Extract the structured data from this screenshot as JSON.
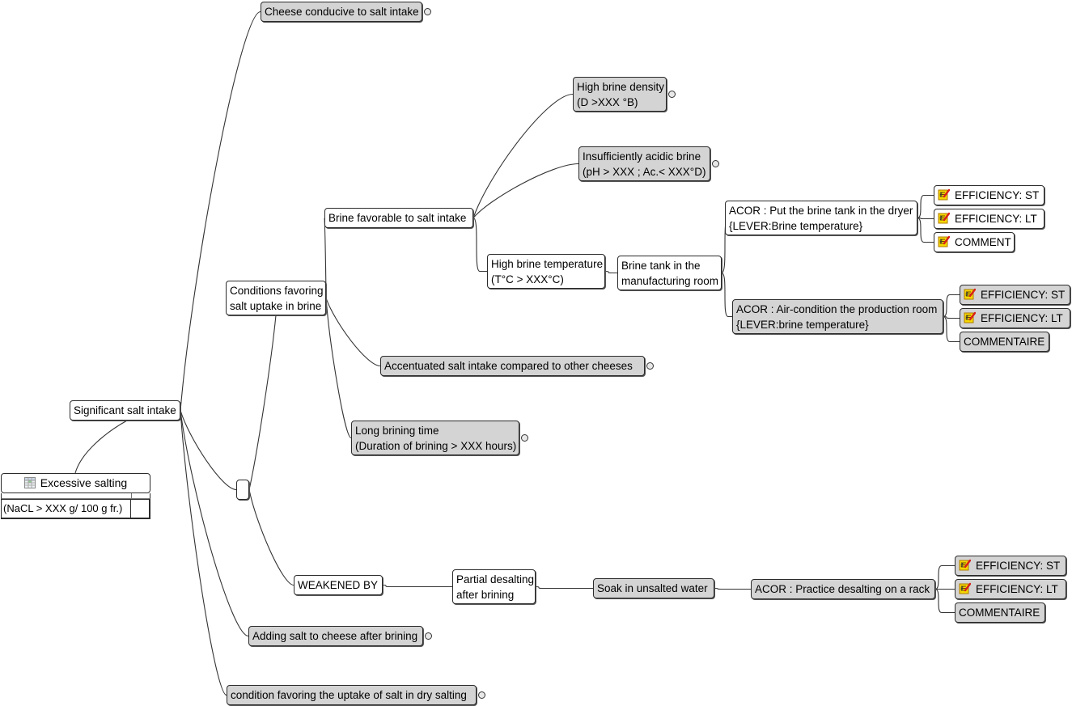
{
  "diagram": {
    "type": "cause-tree mind map",
    "root": {
      "icon": "table-icon",
      "title": "Excessive salting",
      "detail": "(NaCL > XXX g/ 100 g fr.)"
    },
    "nodes": {
      "significant": {
        "lines": [
          "Significant salt intake"
        ]
      },
      "cheese_conducive": {
        "lines": [
          "Cheese conducive to salt intake"
        ]
      },
      "conditions_brine": {
        "lines": [
          "Conditions favoring",
          "salt uptake in brine"
        ]
      },
      "brine_favorable": {
        "lines": [
          "Brine favorable to salt intake"
        ]
      },
      "high_density": {
        "lines": [
          "High brine density",
          "(D >XXX °B)"
        ]
      },
      "acidic": {
        "lines": [
          "Insufficiently acidic brine",
          "(pH > XXX ; Ac.< XXX°D)"
        ]
      },
      "high_temp": {
        "lines": [
          "High brine temperature",
          "(T°C > XXX°C)"
        ]
      },
      "tank_room": {
        "lines": [
          "Brine tank in the",
          "manufacturing room"
        ]
      },
      "acor_dryer": {
        "lines": [
          "ACOR : Put the brine tank in the dryer",
          "{LEVER:Brine temperature}"
        ]
      },
      "acor_dryer_st": {
        "icon": "memo-icon",
        "lines": [
          "EFFICIENCY: ST"
        ]
      },
      "acor_dryer_lt": {
        "icon": "memo-icon",
        "lines": [
          "EFFICIENCY: LT"
        ]
      },
      "acor_dryer_comment": {
        "icon": "memo-icon",
        "lines": [
          "COMMENT"
        ]
      },
      "acor_aircon": {
        "lines": [
          "ACOR : Air-condition the production room",
          "{LEVER:brine temperature}"
        ]
      },
      "acor_aircon_st": {
        "icon": "memo-icon",
        "lines": [
          "EFFICIENCY: ST"
        ]
      },
      "acor_aircon_lt": {
        "icon": "memo-icon",
        "lines": [
          "EFFICIENCY: LT"
        ]
      },
      "acor_aircon_comment": {
        "lines": [
          "COMMENTAIRE"
        ]
      },
      "accentuated": {
        "lines": [
          "Accentuated salt intake compared to other cheeses"
        ]
      },
      "long_brining": {
        "lines": [
          "Long brining time",
          "(Duration of brining > XXX hours)"
        ]
      },
      "junction": {
        "lines": [
          ""
        ]
      },
      "weakened": {
        "lines": [
          "WEAKENED BY"
        ]
      },
      "partial_desalting": {
        "lines": [
          "Partial desalting",
          " after brining"
        ]
      },
      "soak": {
        "lines": [
          "Soak in unsalted water"
        ]
      },
      "acor_rack": {
        "lines": [
          "ACOR : Practice desalting on a rack"
        ]
      },
      "acor_rack_st": {
        "icon": "memo-icon",
        "lines": [
          "EFFICIENCY: ST"
        ]
      },
      "acor_rack_lt": {
        "icon": "memo-icon",
        "lines": [
          "EFFICIENCY: LT"
        ]
      },
      "acor_rack_comment": {
        "lines": [
          "COMMENTAIRE"
        ]
      },
      "adding_salt": {
        "lines": [
          "Adding salt to cheese after brining"
        ]
      },
      "dry_salting": {
        "lines": [
          "condition favoring the uptake of salt in dry salting"
        ]
      }
    },
    "colors": {
      "node_fill_white": "#ffffff",
      "node_fill_gray": "#d4d4d4",
      "border": "#2b2b2b",
      "memo_icon_yellow": "#f5d800",
      "memo_icon_red": "#d8201a"
    }
  }
}
